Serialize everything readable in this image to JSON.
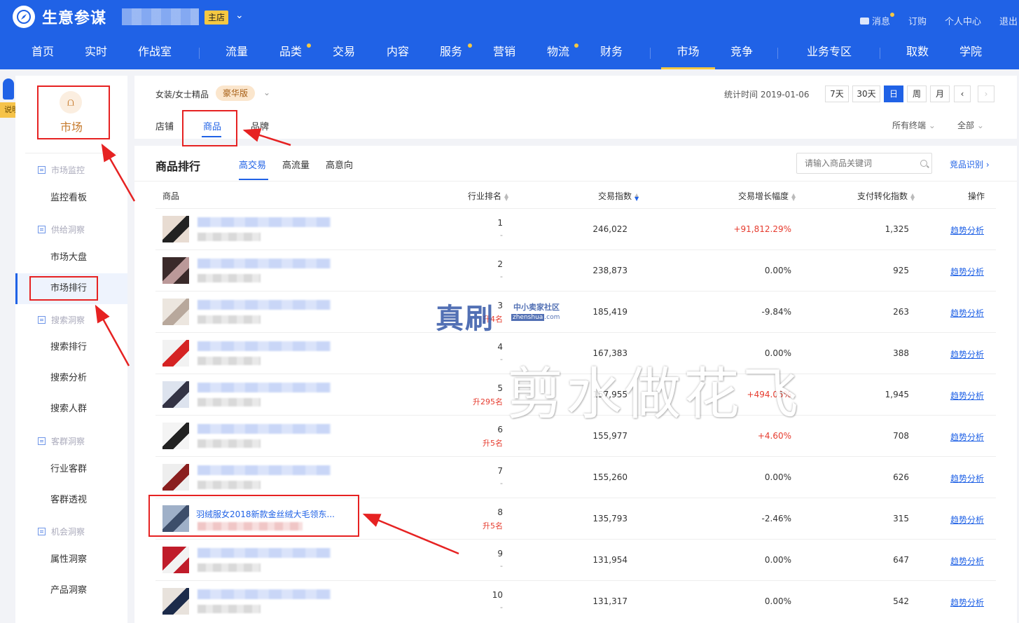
{
  "brand": {
    "name": "生意参谋",
    "shop_tag": "主店"
  },
  "top_links": [
    "消息",
    "订购",
    "个人中心",
    "退出"
  ],
  "nav": [
    "首页",
    "实时",
    "作战室",
    "流量",
    "品类",
    "交易",
    "内容",
    "服务",
    "营销",
    "物流",
    "财务",
    "市场",
    "竞争",
    "业务专区",
    "取数",
    "学院"
  ],
  "active_nav": "市场",
  "help_label": "说明",
  "sidebar": {
    "market_label": "市场",
    "groups": {
      "monitor": "市场监控",
      "supply": "供给洞察",
      "search": "搜索洞察",
      "customer": "客群洞察",
      "opportunity": "机会洞察"
    },
    "items": {
      "dashboard": "监控看板",
      "overview": "市场大盘",
      "ranking": "市场排行",
      "search_rank": "搜索排行",
      "search_analysis": "搜索分析",
      "search_crowd": "搜索人群",
      "industry_crowd": "行业客群",
      "crowd_insight": "客群透视",
      "attr_insight": "属性洞察",
      "product_insight": "产品洞察"
    }
  },
  "filter": {
    "category": "女装/女士精品",
    "edition": "豪华版",
    "stat_time": "统计时间 2019-01-06",
    "periods": [
      "7天",
      "30天",
      "日",
      "周",
      "月"
    ],
    "active_period": "日",
    "prev": "‹",
    "next": "›",
    "subtabs": [
      "店铺",
      "商品",
      "品牌"
    ],
    "active_subtab": "商品",
    "terminal": "所有终端",
    "scope": "全部"
  },
  "ranking": {
    "title": "商品排行",
    "tabs": [
      "高交易",
      "高流量",
      "高意向"
    ],
    "active_tab": "高交易",
    "search_placeholder": "请输入商品关键词",
    "competitor_link": "竞品识别",
    "columns": [
      "商品",
      "行业排名",
      "交易指数",
      "交易增长幅度",
      "支付转化指数",
      "操作"
    ],
    "rows": [
      {
        "rank": "1",
        "change": "-",
        "trade_index": "246,022",
        "growth": "+91,812.29%",
        "conversion": "1,325",
        "action": "趋势分析"
      },
      {
        "rank": "2",
        "change": "-",
        "trade_index": "238,873",
        "growth": "0.00%",
        "conversion": "925",
        "action": "趋势分析"
      },
      {
        "rank": "3",
        "change": "升4名",
        "trade_index": "185,419",
        "growth": "-9.84%",
        "conversion": "263",
        "action": "趋势分析"
      },
      {
        "rank": "4",
        "change": "-",
        "trade_index": "167,383",
        "growth": "0.00%",
        "conversion": "388",
        "action": "趋势分析"
      },
      {
        "rank": "5",
        "change": "升295名",
        "trade_index": "157,955",
        "growth": "+494.05%",
        "conversion": "1,945",
        "action": "趋势分析"
      },
      {
        "rank": "6",
        "change": "升5名",
        "trade_index": "155,977",
        "growth": "+4.60%",
        "conversion": "708",
        "action": "趋势分析"
      },
      {
        "rank": "7",
        "change": "-",
        "trade_index": "155,260",
        "growth": "0.00%",
        "conversion": "626",
        "action": "趋势分析"
      },
      {
        "rank": "8",
        "change": "升5名",
        "trade_index": "135,793",
        "growth": "-2.46%",
        "conversion": "315",
        "action": "趋势分析",
        "title": "羽绒服女2018新款金丝绒大毛领东..."
      },
      {
        "rank": "9",
        "change": "-",
        "trade_index": "131,954",
        "growth": "0.00%",
        "conversion": "647",
        "action": "趋势分析"
      },
      {
        "rank": "10",
        "change": "-",
        "trade_index": "131,317",
        "growth": "0.00%",
        "conversion": "542",
        "action": "趋势分析"
      }
    ]
  },
  "watermarks": {
    "logo": "真刷",
    "logo_tag": "中小卖家社区",
    "logo_url_box": "zhenshua",
    "logo_url_suffix": ".com",
    "overlay": "剪水做花飞"
  },
  "colors": {
    "primary": "#2062e6",
    "accent": "#f5c842",
    "market": "#c67a2c",
    "up": "#e63b2e",
    "annotation": "#e62222"
  }
}
